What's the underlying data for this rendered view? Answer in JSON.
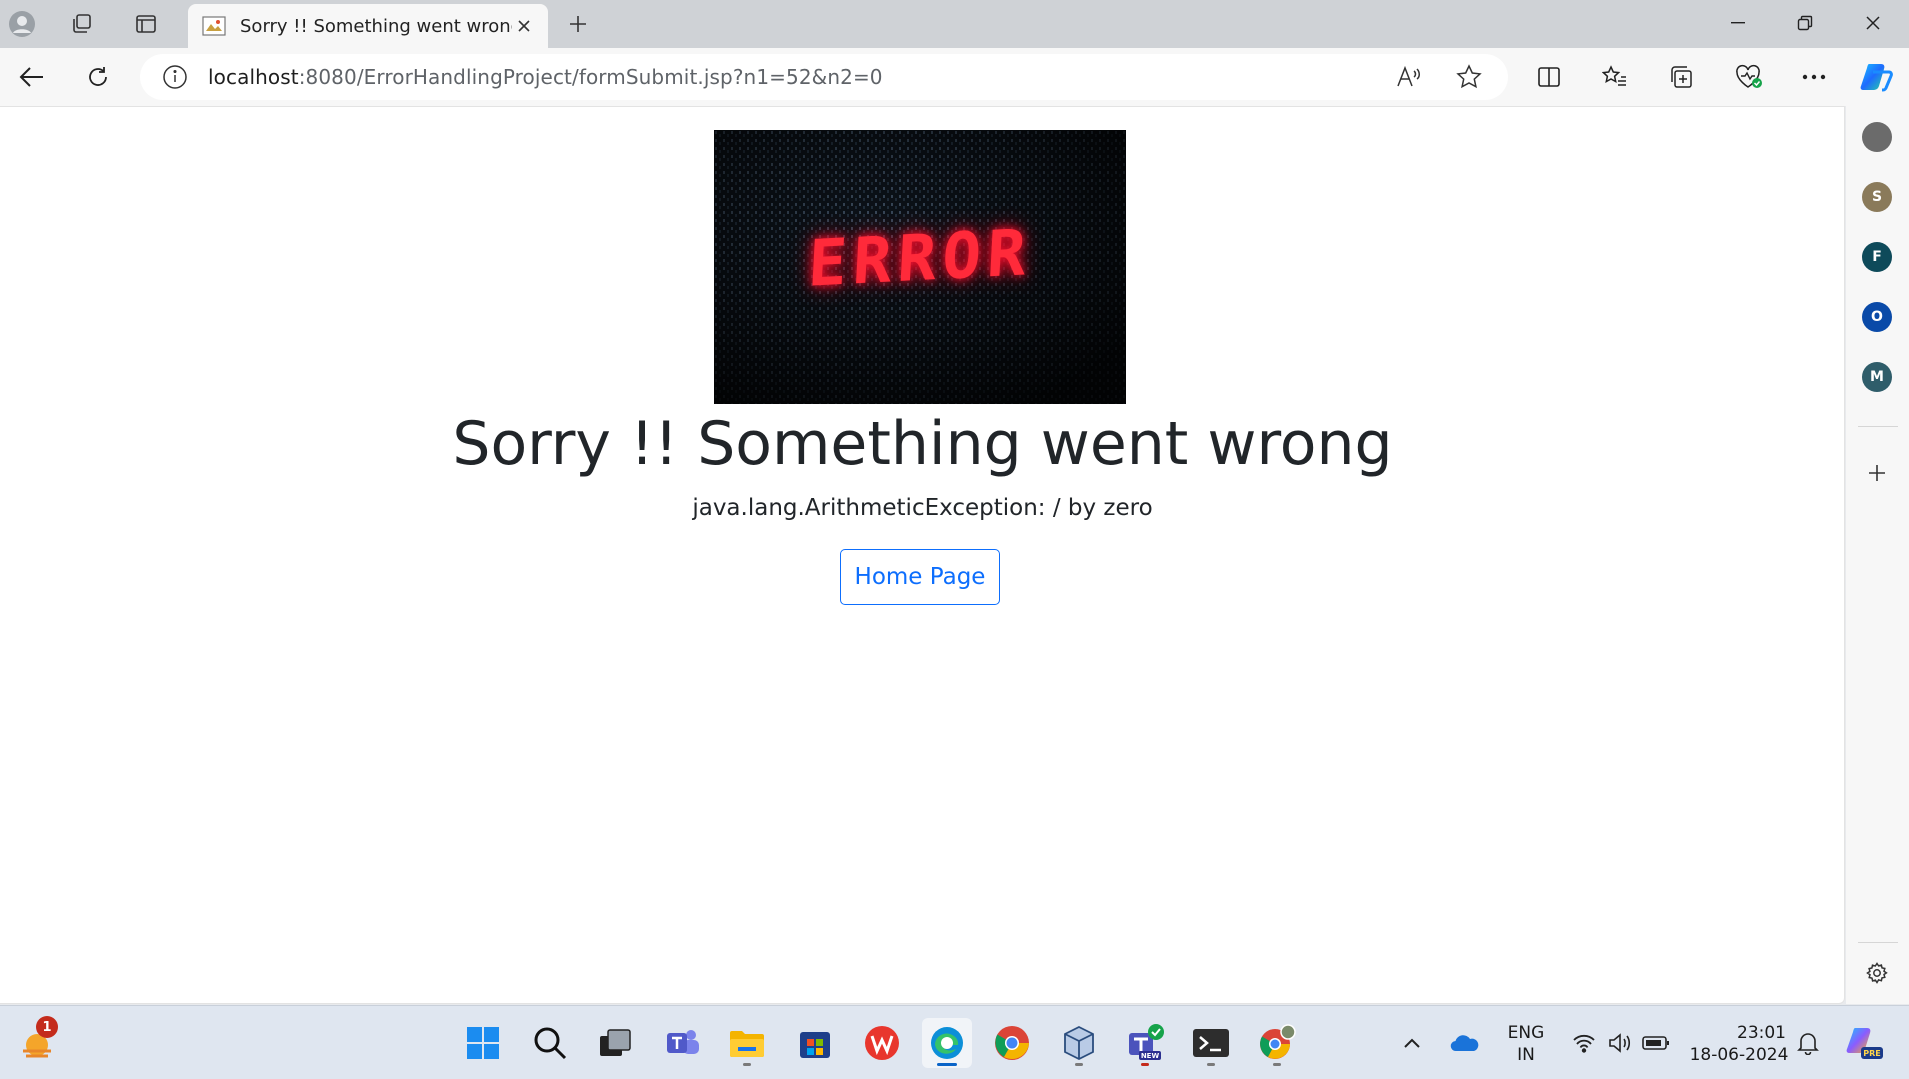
{
  "browser": {
    "tab_title": "Sorry !! Something went wrong...",
    "url_host": "localhost",
    "url_rest": ":8080/ErrorHandlingProject/formSubmit.jsp?n1=52&n2=0"
  },
  "page": {
    "image_text": "ERROR",
    "heading": "Sorry !! Something went wrong",
    "message": "java.lang.ArithmeticException: / by zero",
    "home_button": "Home Page"
  },
  "sidebar": {
    "items": [
      {
        "letter": "",
        "color": "#6b6b6b"
      },
      {
        "letter": "S",
        "color": "#8a7a5a"
      },
      {
        "letter": "F",
        "color": "#0e4a5a"
      },
      {
        "letter": "O",
        "color": "#0a4aa8"
      },
      {
        "letter": "M",
        "color": "#2f5d6a"
      }
    ]
  },
  "taskbar": {
    "weather_badge": "1",
    "lang_line1": "ENG",
    "lang_line2": "IN",
    "time": "23:01",
    "date": "18-06-2024",
    "copilot_badge": "PRE"
  },
  "colors": {
    "accent": "#0d6efd",
    "heading": "#212529",
    "error_red": "#ff2a3a"
  }
}
